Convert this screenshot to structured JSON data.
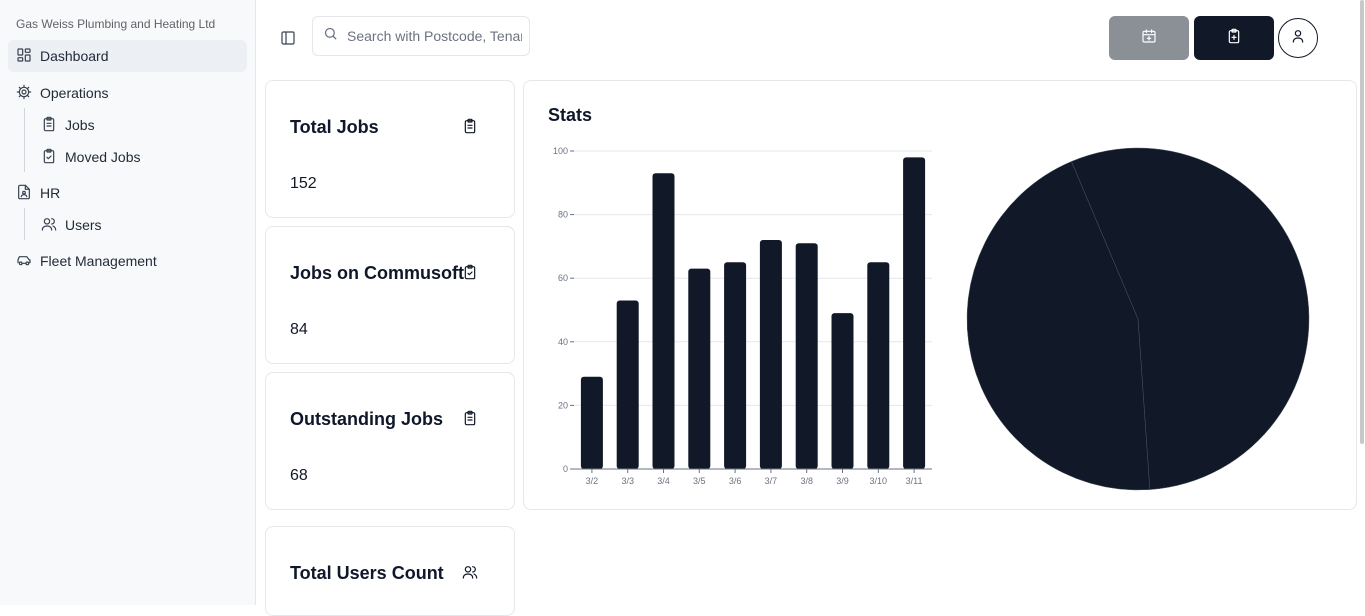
{
  "sidebar": {
    "company": "Gas Weiss Plumbing and Heating Ltd",
    "items": {
      "dashboard": "Dashboard",
      "operations": "Operations",
      "jobs": "Jobs",
      "moved_jobs": "Moved Jobs",
      "hr": "HR",
      "users": "Users",
      "fleet": "Fleet Management"
    }
  },
  "header": {
    "search_placeholder": "Search with Postcode, Tenant, Address",
    "calendar_icon": "calendar-plus-icon",
    "add_job_icon": "clipboard-plus-icon",
    "profile_icon": "user-icon"
  },
  "cards": [
    {
      "title": "Total Jobs",
      "value": "152",
      "icon": "clipboard-list-icon"
    },
    {
      "title": "Jobs on Commusoft",
      "value": "84",
      "icon": "clipboard-check-icon"
    },
    {
      "title": "Outstanding Jobs",
      "value": "68",
      "icon": "clipboard-list-icon"
    },
    {
      "title": "Total Users Count",
      "value": "",
      "icon": "users-icon"
    }
  ],
  "stats": {
    "title": "Stats"
  },
  "colors": {
    "bar": "#111827",
    "pie": "#111827",
    "sidebar_bg": "#f8f9fa"
  },
  "chart_data": [
    {
      "type": "bar",
      "categories": [
        "3/2",
        "3/3",
        "3/4",
        "3/5",
        "3/6",
        "3/7",
        "3/8",
        "3/9",
        "3/10",
        "3/11"
      ],
      "values": [
        29,
        53,
        93,
        63,
        65,
        72,
        71,
        49,
        65,
        98
      ],
      "yticks": [
        0,
        20,
        40,
        60,
        80,
        100
      ],
      "ylim": [
        0,
        100
      ],
      "grid": true
    },
    {
      "type": "pie",
      "values": [
        84,
        68
      ],
      "note_total": 152
    }
  ]
}
